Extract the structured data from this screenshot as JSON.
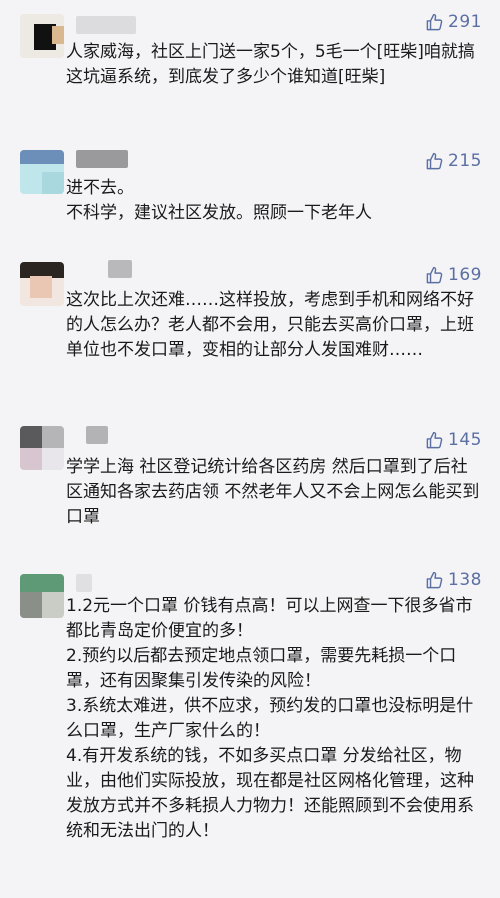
{
  "colors": {
    "background": "#f4f4f6",
    "text": "#1a1a1a",
    "like": "#5b6fa3"
  },
  "like_icon": "thumbs-up-outline",
  "comments": [
    {
      "likes": "291",
      "text": "人家威海，社区上门送一家5个，5毛一个[旺柴]咱就搞这坑逼系统，到底发了多少个谁知道[旺柴]"
    },
    {
      "likes": "215",
      "text": "进不去。\n不科学，建议社区发放。照顾一下老年人"
    },
    {
      "likes": "169",
      "text": "这次比上次还难……这样投放，考虑到手机和网络不好的人怎么办？老人都不会用，只能去买高价口罩，上班单位也不发口罩，变相的让部分人发国难财……"
    },
    {
      "likes": "145",
      "text": "学学上海 社区登记统计给各区药房 然后口罩到了后社区通知各家去药店领 不然老年人又不会上网怎么能买到口罩"
    },
    {
      "likes": "138",
      "text": "1.2元一个口罩 价钱有点高！可以上网查一下很多省市都比青岛定价便宜的多！\n2.预约以后都去预定地点领口罩，需要先耗损一个口罩，还有因聚集引发传染的风险！\n3.系统太难进，供不应求，预约发的口罩也没标明是什么口罩，生产厂家什么的！\n4.有开发系统的钱，不如多买点口罩 分发给社区，物业，由他们实际投放，现在都是社区网格化管理，这种发放方式并不多耗损人力物力！还能照顾到不会使用系统和无法出门的人！"
    }
  ]
}
